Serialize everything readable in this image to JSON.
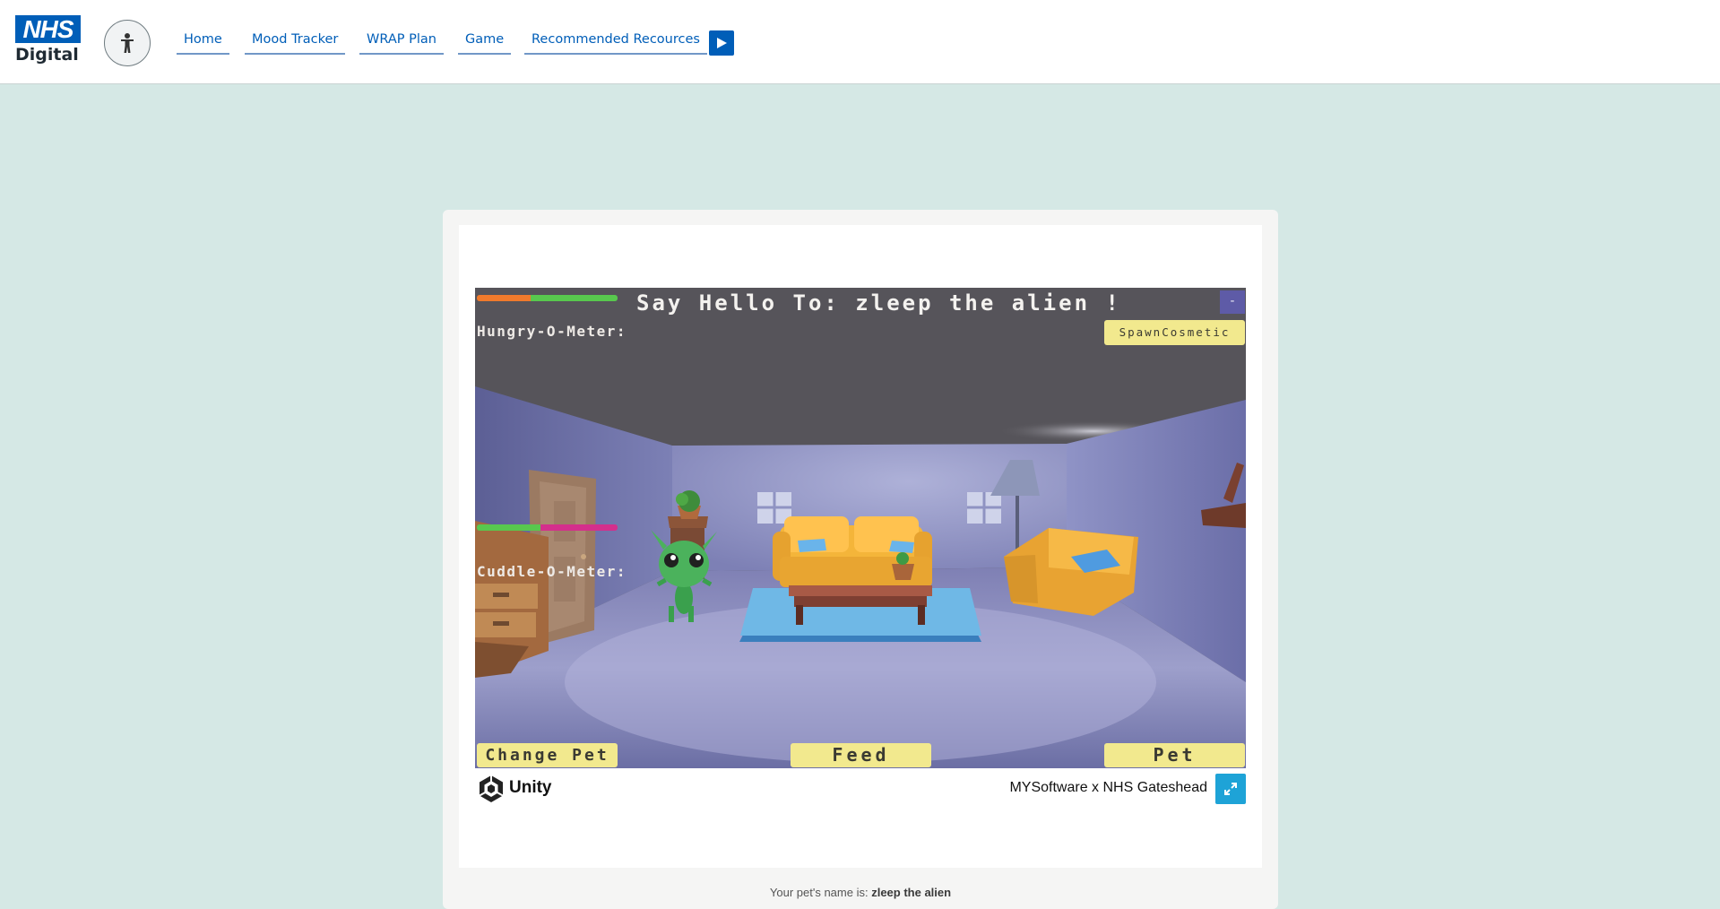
{
  "header": {
    "logo": {
      "top": "NHS",
      "bottom": "Digital"
    },
    "accessibility_icon": "person-icon",
    "nav": [
      {
        "label": "Home"
      },
      {
        "label": "Mood Tracker"
      },
      {
        "label": "WRAP Plan"
      },
      {
        "label": "Game"
      },
      {
        "label": "Recommended Recources"
      }
    ],
    "play_icon": "play-icon"
  },
  "game": {
    "title": "Say Hello To: zleep the alien !",
    "minimize_label": "-",
    "hungry_label": "Hungry-O-Meter:",
    "hungry_level": 0.38,
    "cuddle_label": "Cuddle-O-Meter:",
    "cuddle_level": 0.45,
    "spawn_label": "SpawnCosmetic",
    "change_pet_label": "Change Pet",
    "feed_label": "Feed",
    "pet_label": "Pet"
  },
  "footer": {
    "unity_label": "Unity",
    "credit": "MYSoftware x NHS Gateshead",
    "fullscreen_icon": "fullscreen-icon"
  },
  "pet_info": {
    "prefix": "Your pet's name is: ",
    "name": "zleep the alien"
  },
  "colors": {
    "nhs_blue": "#005eb8",
    "page_bg": "#d5e8e5",
    "button_yellow": "#f2e98e",
    "hunger_orange": "#f07a2c",
    "meter_green": "#58c84e",
    "cuddle_pink": "#d42f8c"
  }
}
